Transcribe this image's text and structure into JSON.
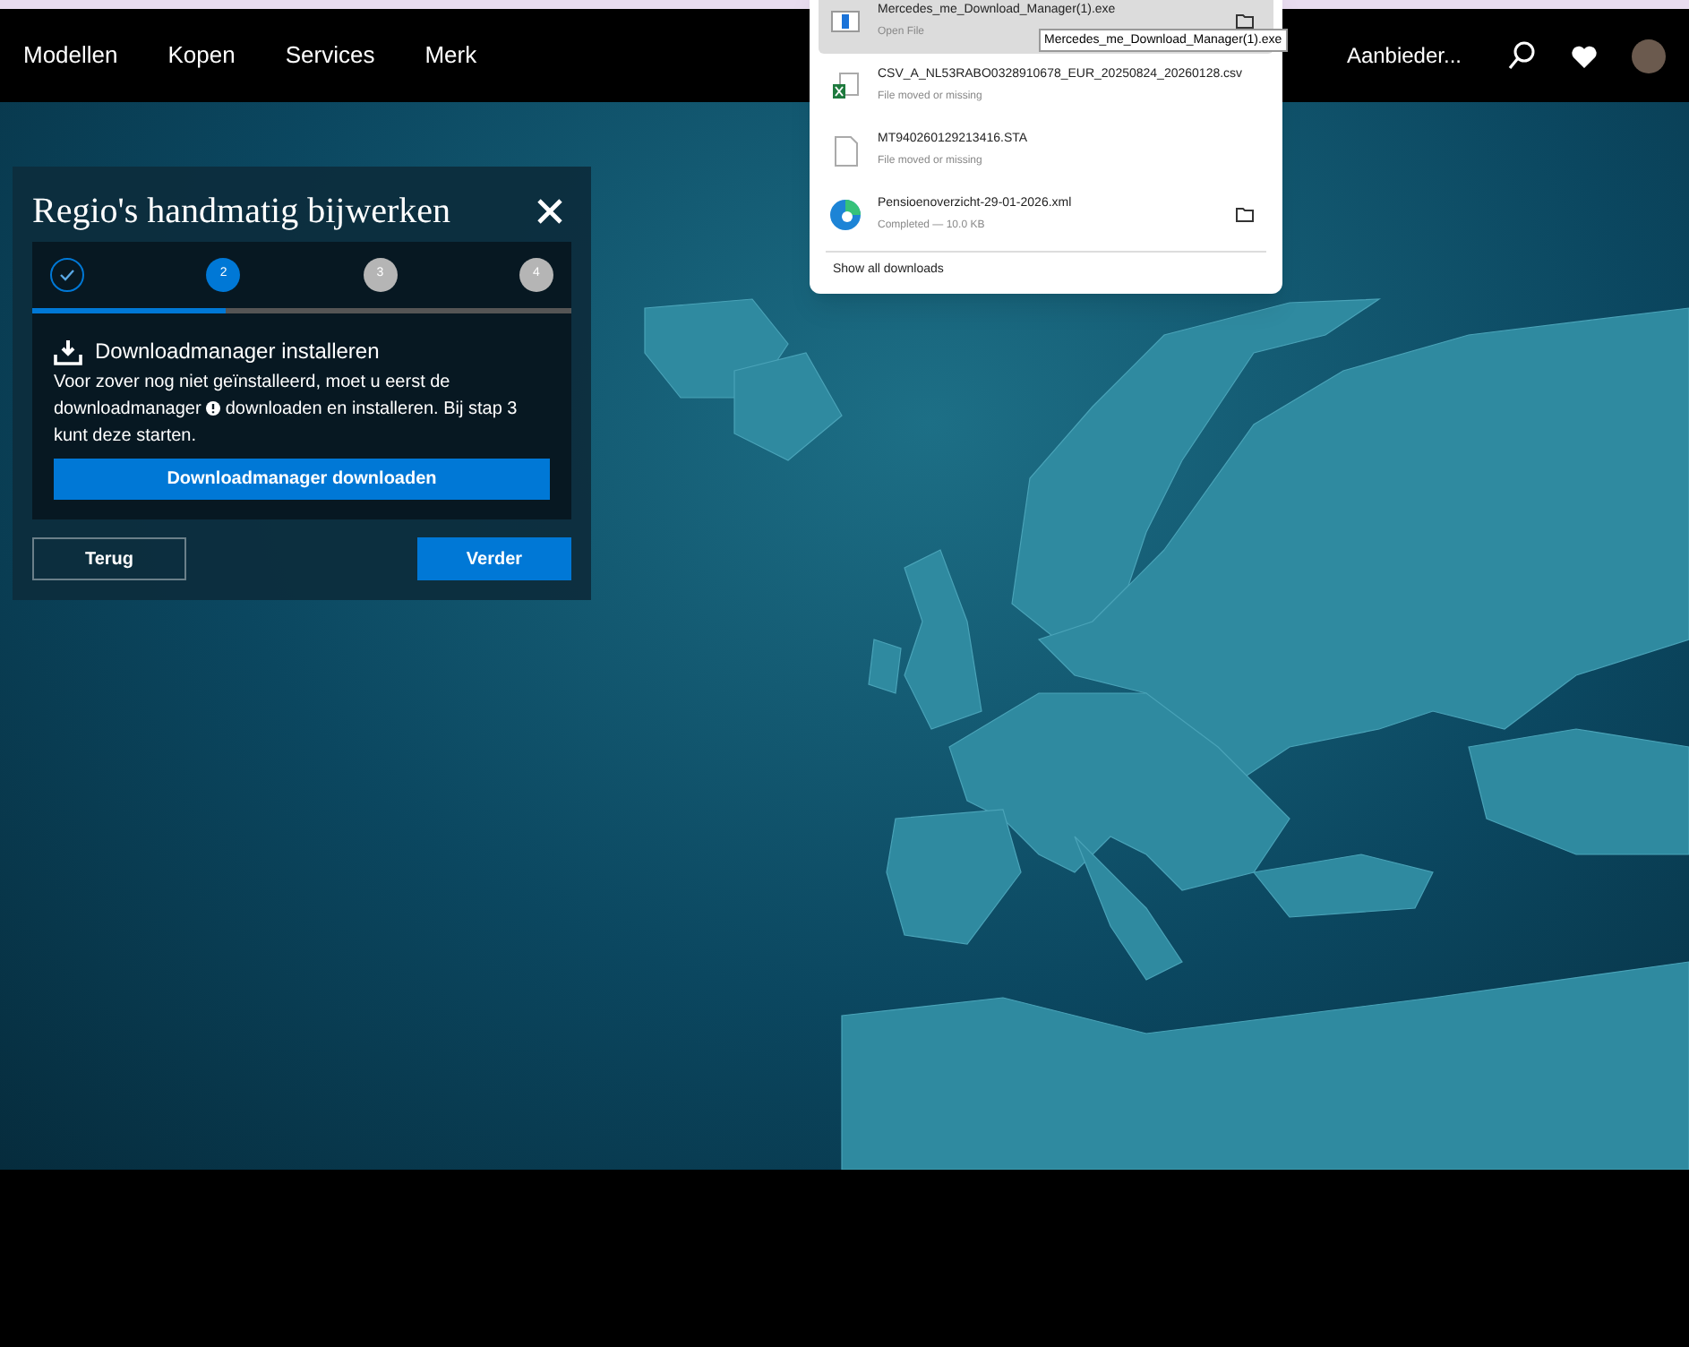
{
  "header": {
    "nav": [
      {
        "label": "Modellen"
      },
      {
        "label": "Kopen"
      },
      {
        "label": "Services"
      },
      {
        "label": "Merk"
      }
    ],
    "dealer": "Aanbieder..."
  },
  "dialog": {
    "title": "Regio's handmatig bijwerken",
    "steps": [
      {
        "done": true,
        "selected": false
      },
      {
        "label": "2",
        "done": false,
        "selected": true
      },
      {
        "label": "3",
        "done": false,
        "selected": false
      },
      {
        "label": "4",
        "done": false,
        "selected": false
      }
    ],
    "progress": {
      "level": 0.36
    },
    "section_title": "Downloadmanager installeren",
    "body_before": "Voor zover nog niet geïnstalleerd, moet u eerst de downloadmanager",
    "body_after": "downloaden en installeren. Bij stap 3 kunt deze starten.",
    "primary_button": "Downloadmanager downloaden",
    "back_button": "Terug",
    "next_button": "Verder"
  },
  "downloads": {
    "items": [
      {
        "kind": "exe",
        "name": "Mercedes_me_Download_Manager(1).exe",
        "status": "Open File",
        "selected": true,
        "folder": true
      },
      {
        "kind": "excel",
        "name": "CSV_A_NL53RABO0328910678_EUR_20250824_20260128.csv",
        "status": "File moved or missing",
        "selected": false,
        "folder": false
      },
      {
        "kind": "file",
        "name": "MT940260129213416.STA",
        "status": "File moved or missing",
        "selected": false,
        "folder": false
      },
      {
        "kind": "edge",
        "name": "Pensioenoverzicht-29-01-2026.xml",
        "status": "Completed — 10.0 KB",
        "selected": false,
        "folder": true
      }
    ],
    "show_all": "Show all downloads",
    "tooltip": "Mercedes_me_Download_Manager(1).exe"
  }
}
